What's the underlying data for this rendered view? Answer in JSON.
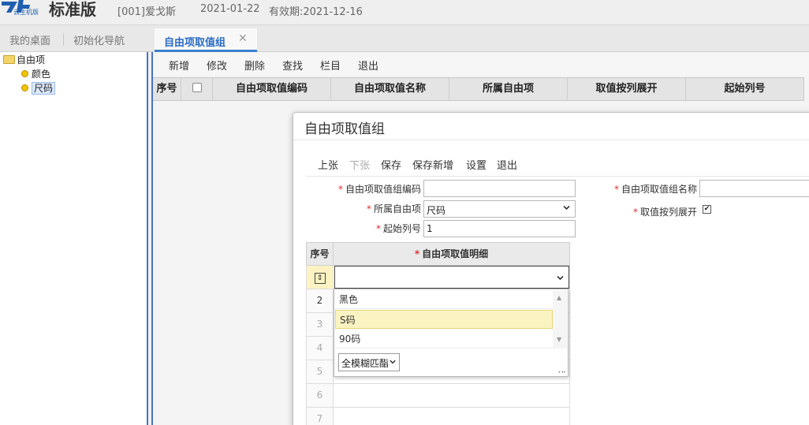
{
  "header": {
    "logo_sub": "云主机版",
    "edition": "标准版",
    "account": "[001]爱戈斯",
    "date": "2021-01-22",
    "validity": "有效期:2021-12-16"
  },
  "tabs": {
    "my_desktop": "我的桌面",
    "init_nav": "初始化导航",
    "active": "自由项取值组",
    "close": "✕"
  },
  "sidebar": {
    "root": "自由项",
    "items": [
      "颜色",
      "尺码"
    ]
  },
  "toolbar": {
    "buttons": [
      "新增",
      "修改",
      "删除",
      "查找",
      "栏目",
      "退出"
    ]
  },
  "grid": {
    "columns": [
      "序号",
      "自由项取值编码",
      "自由项取值名称",
      "所属自由项",
      "取值按列展开",
      "起始列号"
    ]
  },
  "dialog": {
    "title": "自由项取值组",
    "buttons": [
      "上张",
      "下张",
      "保存",
      "保存新增",
      "设置",
      "退出"
    ],
    "fields": {
      "code_label": "自由项取值组编码",
      "code_value": "",
      "name_label": "自由项取值组名称",
      "name_value": "",
      "belong_label": "所属自由项",
      "belong_value": "尺码",
      "expand_label": "取值按列展开",
      "expand_checked": true,
      "start_label": "起始列号",
      "start_value": "1"
    },
    "detail_grid": {
      "col_no": "序号",
      "col_detail": "自由项取值明细",
      "row_numbers": [
        "2",
        "3",
        "4",
        "5",
        "6",
        "7"
      ]
    }
  },
  "dropdown": {
    "options": [
      "黑色",
      "S码",
      "90码"
    ],
    "highlighted_index": 1,
    "match_mode": "全模糊匹酯"
  },
  "colors": {
    "accent": "#3b7fd0",
    "required": "#e03030",
    "highlight": "#fcf3c2"
  }
}
